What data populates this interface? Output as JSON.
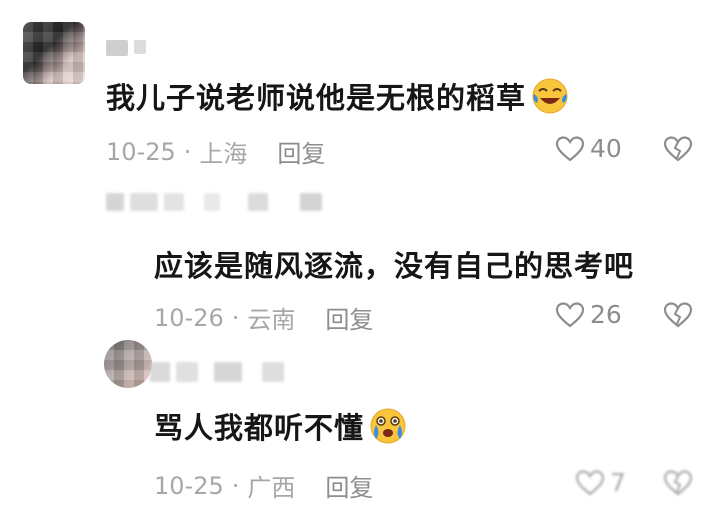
{
  "comments": [
    {
      "text": "我儿子说老师说他是无根的稻草",
      "emoji": "laugh-cry-emoji",
      "date": "10-25",
      "location": "上海",
      "reply_label": "回复",
      "likes": "40"
    },
    {
      "text": "应该是随风逐流，没有自己的思考吧",
      "date": "10-26",
      "location": "云南",
      "reply_label": "回复",
      "likes": "26"
    },
    {
      "text": "骂人我都听不懂",
      "emoji": "crying-emoji",
      "date": "10-25",
      "location": "广西",
      "reply_label": "回复",
      "likes": "7"
    }
  ],
  "separator": "·",
  "colors": {
    "text": "#161616",
    "meta": "#a7a7a7",
    "icon": "#8d8d8d",
    "emoji_face": "#f9c53a",
    "emoji_tear": "#3c8fe0"
  }
}
